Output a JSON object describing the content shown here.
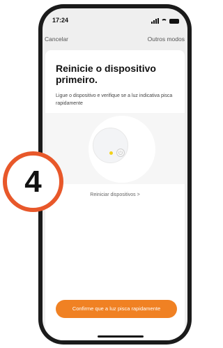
{
  "status_bar": {
    "time": "17:24"
  },
  "nav": {
    "cancel": "Cancelar",
    "other_modes": "Outros modos"
  },
  "content": {
    "title": "Reinicie o dispositivo primeiro.",
    "subtitle": "Ligue o dispositivo e verifique se a luz indicativa pisca rapidamente",
    "restart_link": "Reiniciar dispositivos >"
  },
  "step_badge": "4",
  "confirm_button": "Confirme que a luz pisca rapidamente",
  "colors": {
    "accent": "#f08123",
    "badge_ring": "#e8582a",
    "led": "#f2d11b"
  }
}
